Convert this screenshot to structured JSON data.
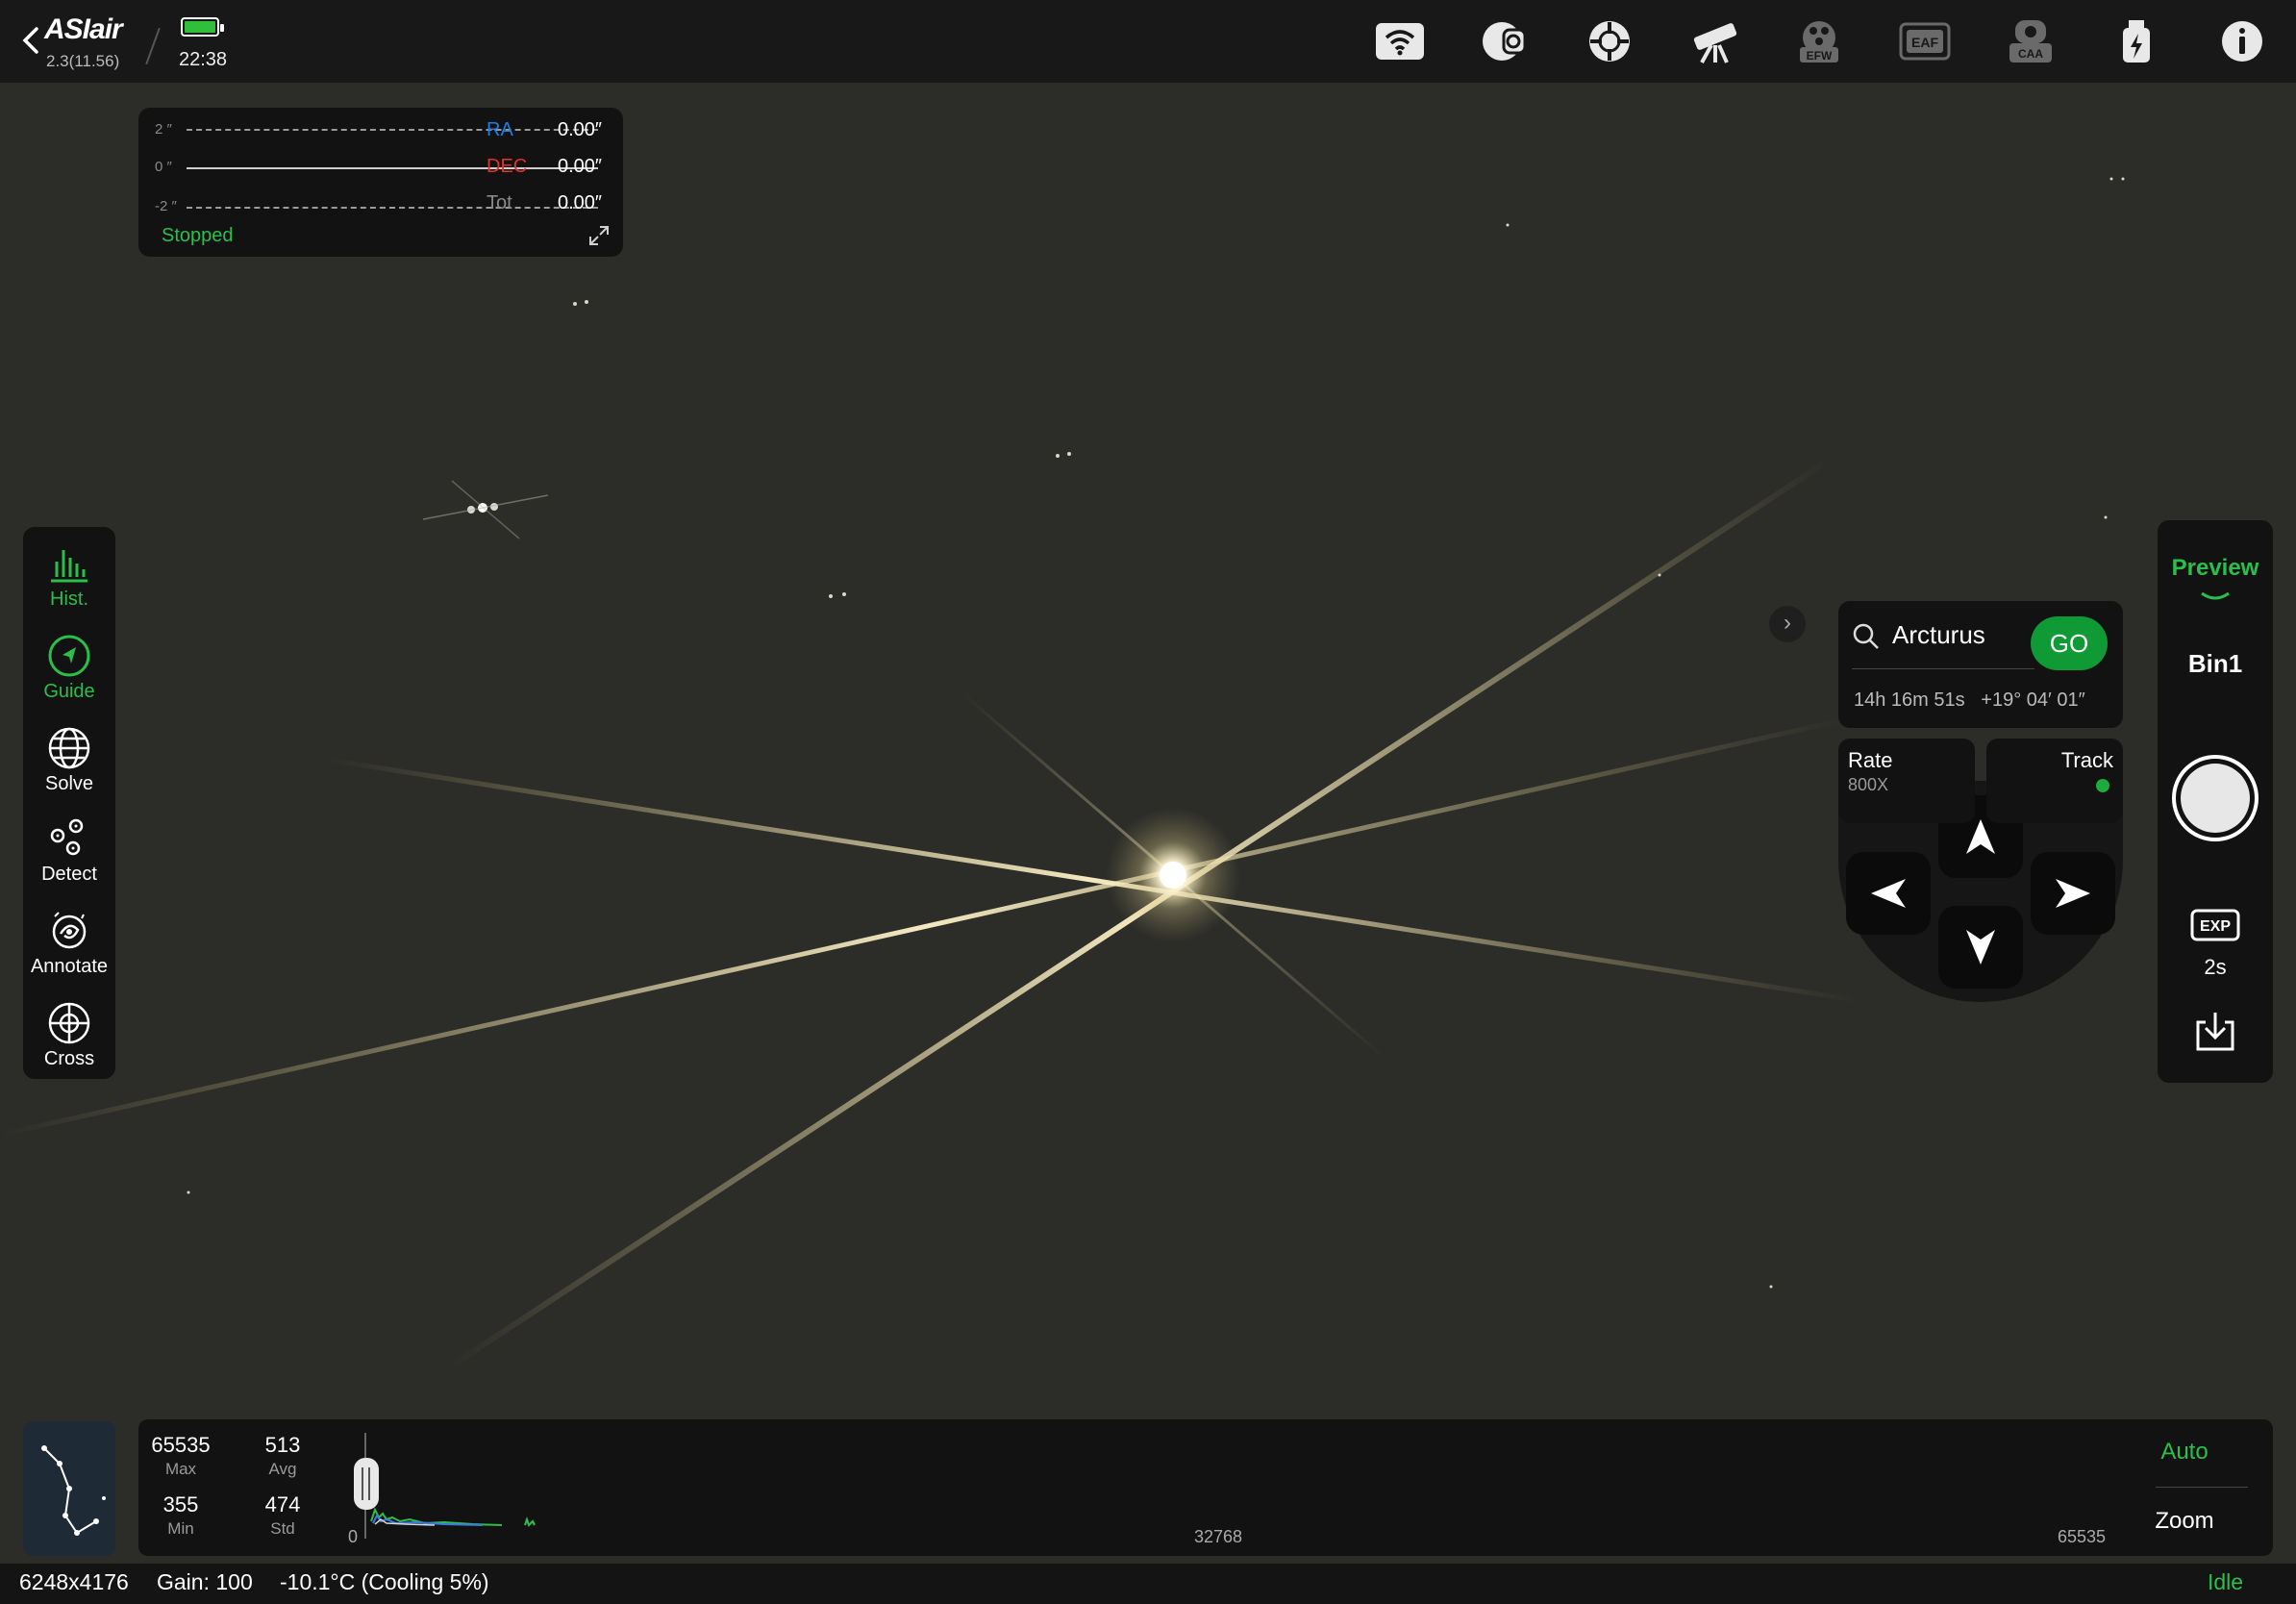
{
  "header": {
    "logo": "ASIair",
    "version": "2.3(11.56)",
    "time": "22:38",
    "icons": [
      "wifi-icon",
      "camera-icon",
      "guide-scope-icon",
      "telescope-icon",
      "efw-icon",
      "eaf-icon",
      "caa-icon",
      "usb-power-icon",
      "info-icon"
    ],
    "efw_label": "EFW",
    "eaf_label": "EAF",
    "caa_label": "CAA",
    "battery_color": "#2fbf3a"
  },
  "guide_graph": {
    "scale_labels": [
      "2 ″",
      "0 ″",
      "-2 ″"
    ],
    "ra_label": "RA",
    "ra_value": "0.00″",
    "dec_label": "DEC",
    "dec_value": "0.00″",
    "tot_label": "Tot",
    "tot_value": "0.00″",
    "status": "Stopped",
    "ra_color": "#1e7fe0",
    "dec_color": "#e0332b"
  },
  "tools": [
    {
      "label": "Hist.",
      "icon": "histogram-icon",
      "active": true
    },
    {
      "label": "Guide",
      "icon": "guide-icon",
      "active": true
    },
    {
      "label": "Solve",
      "icon": "globe-icon",
      "active": false
    },
    {
      "label": "Detect",
      "icon": "detect-icon",
      "active": false
    },
    {
      "label": "Annotate",
      "icon": "annotate-icon",
      "active": false
    },
    {
      "label": "Cross",
      "icon": "crosshair-icon",
      "active": false
    }
  ],
  "goto": {
    "target": "Arcturus",
    "go_label": "GO",
    "coords": "14h 16m 51s   +19° 04′ 01″",
    "collapse": "›"
  },
  "mount": {
    "rate_label": "Rate",
    "rate_value": "800X",
    "track_label": "Track",
    "track_on": true
  },
  "capture": {
    "mode": "Preview",
    "bin": "Bin1",
    "exp_label": "EXP",
    "exposure": "2s"
  },
  "histogram": {
    "max_value": "65535",
    "max_label": "Max",
    "avg_value": "513",
    "avg_label": "Avg",
    "min_value": "355",
    "min_label": "Min",
    "std_value": "474",
    "std_label": "Std",
    "axis_start": "0",
    "axis_mid": "32768",
    "axis_end": "65535",
    "auto_label": "Auto",
    "zoom_label": "Zoom"
  },
  "status_bar": {
    "resolution": "6248x4176",
    "gain": "Gain: 100",
    "temperature": "-10.1°C (Cooling 5%)",
    "state": "Idle"
  },
  "colors": {
    "accent_green": "#2bbf4a",
    "go_green": "#0f9a35",
    "panel_bg": "#121212",
    "sky_bg": "#2c2d29"
  }
}
